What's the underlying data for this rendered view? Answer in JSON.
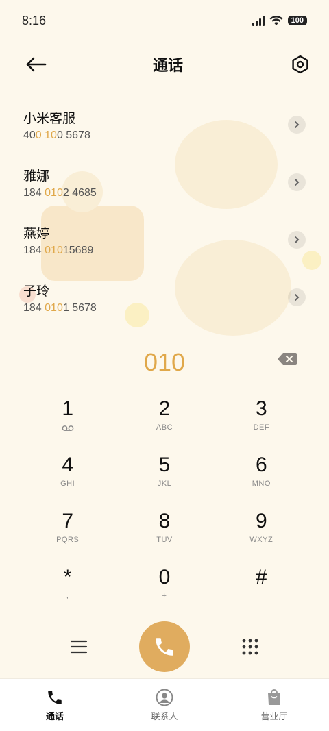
{
  "status": {
    "time": "8:16",
    "battery": "100"
  },
  "header": {
    "title": "通话",
    "back_icon": "arrow-left-icon",
    "settings_icon": "hexagon-settings-icon"
  },
  "contacts": [
    {
      "name": "小米客服",
      "number_parts": [
        "400 ",
        "10",
        "0 5678"
      ],
      "pre": "40",
      "hl": "0 10",
      "post": "0 5678"
    },
    {
      "name": "雅娜",
      "pre": "184 ",
      "hl": "010",
      "post": "2 4685"
    },
    {
      "name": "燕婷",
      "pre": "184 ",
      "hl": "010",
      "post": "15689"
    },
    {
      "name": "子玲",
      "pre": "184 ",
      "hl": "010",
      "post": "1 5678"
    }
  ],
  "dialer": {
    "input": "010",
    "keys": [
      {
        "digit": "1",
        "sub": "voicemail"
      },
      {
        "digit": "2",
        "sub": "ABC"
      },
      {
        "digit": "3",
        "sub": "DEF"
      },
      {
        "digit": "4",
        "sub": "GHI"
      },
      {
        "digit": "5",
        "sub": "JKL"
      },
      {
        "digit": "6",
        "sub": "MNO"
      },
      {
        "digit": "7",
        "sub": "PQRS"
      },
      {
        "digit": "8",
        "sub": "TUV"
      },
      {
        "digit": "9",
        "sub": "WXYZ"
      },
      {
        "digit": "*",
        "sub": ","
      },
      {
        "digit": "0",
        "sub": "+"
      },
      {
        "digit": "#",
        "sub": ""
      }
    ]
  },
  "nav": {
    "items": [
      {
        "label": "通话",
        "icon": "phone-icon",
        "active": true
      },
      {
        "label": "联系人",
        "icon": "person-icon",
        "active": false
      },
      {
        "label": "营业厅",
        "icon": "shopping-bag-icon",
        "active": false
      }
    ]
  },
  "colors": {
    "accent": "#e0a84a",
    "call_button": "#e0ac5f",
    "background": "#fdf8ec"
  }
}
